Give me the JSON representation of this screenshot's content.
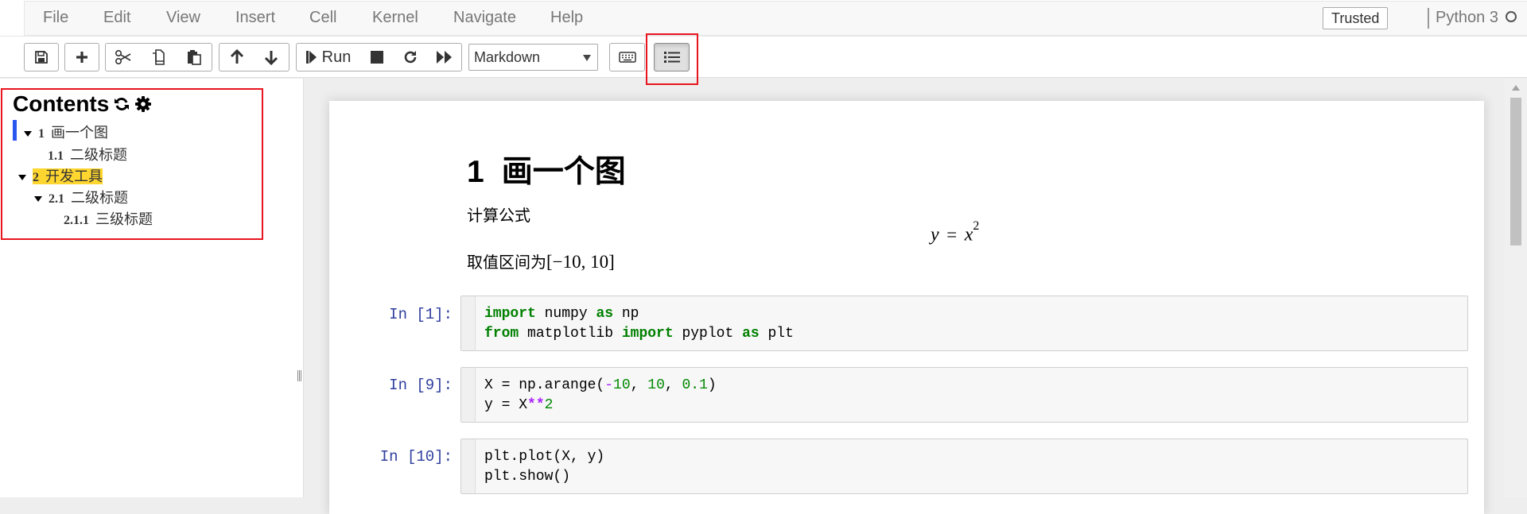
{
  "menubar": {
    "items": [
      "File",
      "Edit",
      "View",
      "Insert",
      "Cell",
      "Kernel",
      "Navigate",
      "Help"
    ],
    "trusted_label": "Trusted",
    "kernel_name": "Python 3"
  },
  "toolbar": {
    "run_label": "Run",
    "cell_type": "Markdown"
  },
  "toc": {
    "title": "Contents",
    "items": [
      {
        "number": "1",
        "label": "画一个图"
      },
      {
        "number": "1.1",
        "label": "二级标题"
      },
      {
        "number": "2",
        "label": "开发工具"
      },
      {
        "number": "2.1",
        "label": "二级标题"
      },
      {
        "number": "2.1.1",
        "label": "三级标题"
      }
    ]
  },
  "notebook": {
    "heading_number": "1",
    "heading_text": "画一个图",
    "text1": "计算公式",
    "formula_lhs": "y",
    "formula_eq": "=",
    "formula_base": "x",
    "formula_exp": "2",
    "text2": "取值区间为",
    "interval": "[−10, 10]",
    "cells": [
      {
        "prompt": "In  [1]:",
        "lines": [
          "import numpy as np",
          "from matplotlib import pyplot as plt"
        ]
      },
      {
        "prompt": "In  [9]:",
        "lines": [
          "X = np.arange(-10, 10, 0.1)",
          "y = X**2"
        ]
      },
      {
        "prompt": "In  [10]:",
        "lines": [
          "plt.plot(X, y)",
          "plt.show()"
        ]
      }
    ]
  },
  "highlight_color": "#e8141e",
  "toc_active_color": "#ffd630"
}
